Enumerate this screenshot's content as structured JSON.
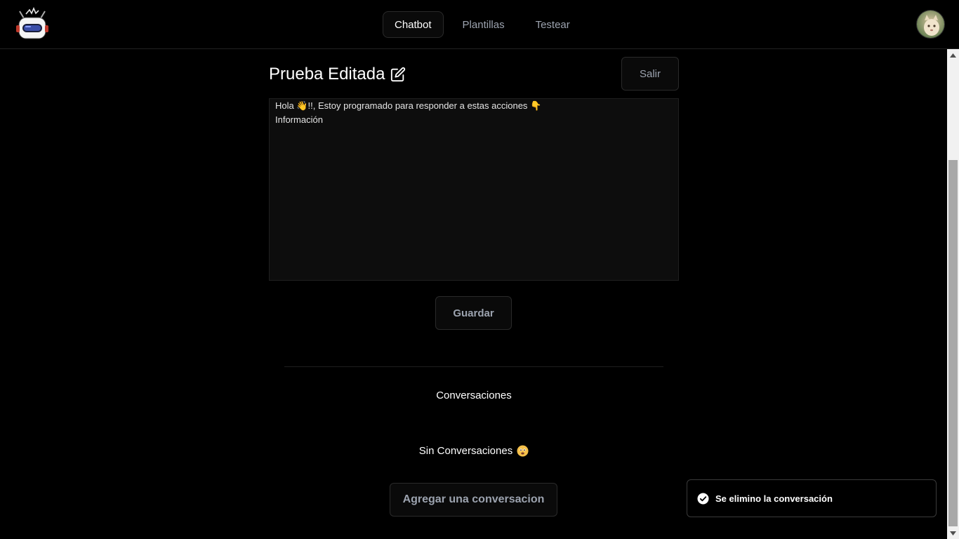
{
  "nav": {
    "tabs": [
      {
        "label": "Chatbot",
        "active": true
      },
      {
        "label": "Plantillas",
        "active": false
      },
      {
        "label": "Testear",
        "active": false
      }
    ]
  },
  "bot": {
    "title": "Prueba Editada",
    "exit_label": "Salir",
    "message_lines": [
      "Hola 👋!!, Estoy programado para responder a estas acciones 👇",
      "Información"
    ],
    "save_label": "Guardar"
  },
  "conversations": {
    "title": "Conversaciones",
    "empty_text": "Sin Conversaciones",
    "add_label": "Agregar una conversacion"
  },
  "toast": {
    "message": "Se elimino la conversación"
  },
  "colors": {
    "background": "#000000",
    "border": "#2a2a2a",
    "muted_text": "#9ca3af",
    "logo_accent": "#3b4ea8"
  }
}
